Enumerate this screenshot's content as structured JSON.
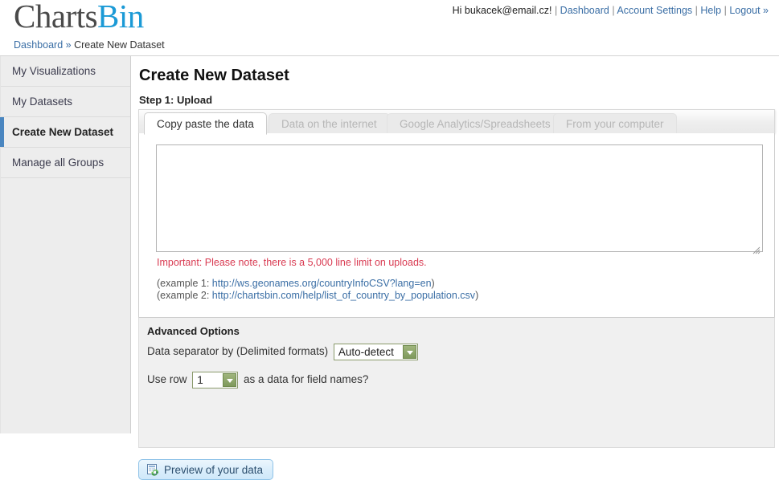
{
  "header": {
    "logo": {
      "part1": "Charts",
      "part2": "Bin"
    },
    "user_nav": {
      "greeting": "Hi bukacek@email.cz!",
      "links": [
        {
          "label": "Dashboard"
        },
        {
          "label": "Account Settings"
        },
        {
          "label": "Help"
        },
        {
          "label": "Logout »"
        }
      ],
      "separator": "|"
    },
    "breadcrumb": {
      "root": "Dashboard",
      "chevron": "»",
      "current": "Create New Dataset"
    }
  },
  "sidebar": {
    "items": [
      {
        "label": "My Visualizations",
        "active": false
      },
      {
        "label": "My Datasets",
        "active": false
      },
      {
        "label": "Create New Dataset",
        "active": true
      },
      {
        "label": "Manage all Groups",
        "active": false
      }
    ],
    "accent_color": "#4a86c0"
  },
  "main": {
    "page_title": "Create New Dataset",
    "step_label": "Step 1: Upload",
    "tabs": [
      {
        "label": "Copy paste the data",
        "active": true
      },
      {
        "label": "Data on the internet",
        "active": false
      },
      {
        "label": "Google Analytics/Spreadsheets",
        "active": false
      },
      {
        "label": "From your computer",
        "active": false
      }
    ],
    "paste": {
      "value": "",
      "placeholder": ""
    },
    "important_note": "Important: Please note, there is a 5,000 line limit on uploads.",
    "examples": [
      {
        "prefix": "(example 1: ",
        "url": "http://ws.geonames.org/countryInfoCSV?lang=en",
        "suffix": ")"
      },
      {
        "prefix": "(example 2: ",
        "url": "http://chartsbin.com/help/list_of_country_by_population.csv",
        "suffix": ")"
      }
    ],
    "advanced": {
      "title": "Advanced Options",
      "separator_label": "Data separator by (Delimited formats)",
      "separator_value": "Auto-detect",
      "row_label_before": "Use row",
      "row_value": "1",
      "row_label_after": "as a data for field names?"
    },
    "preview_button": {
      "label": "Preview of your data",
      "icon": "preview-data-icon"
    }
  },
  "colors": {
    "link": "#3a6ea5",
    "warning": "#d93b52",
    "logo_accent": "#1b9ad6",
    "select_border": "#8a9a6c"
  }
}
